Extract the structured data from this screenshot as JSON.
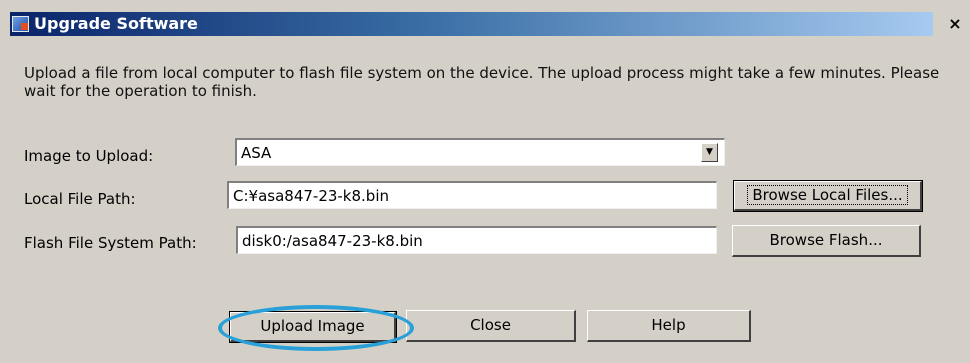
{
  "window": {
    "title": "Upgrade Software",
    "close_glyph": "×",
    "app_icon": "asdm-app-icon"
  },
  "description": "Upload a file from local computer to flash file system on the device. The upload process might take a few minutes. Please wait for the operation to finish.",
  "form": {
    "image_label": "Image to Upload:",
    "image_value": "ASA",
    "local_path_label": "Local File Path:",
    "local_path_value": "C:¥asa847-23-k8.bin",
    "flash_path_label": "Flash File System Path:",
    "flash_path_value": "disk0:/asa847-23-k8.bin"
  },
  "buttons": {
    "browse_local": "Browse Local Files...",
    "browse_flash": "Browse Flash...",
    "upload": "Upload Image",
    "close": "Close",
    "help": "Help"
  },
  "annotation": {
    "highlight_color": "#2aa0d8"
  }
}
